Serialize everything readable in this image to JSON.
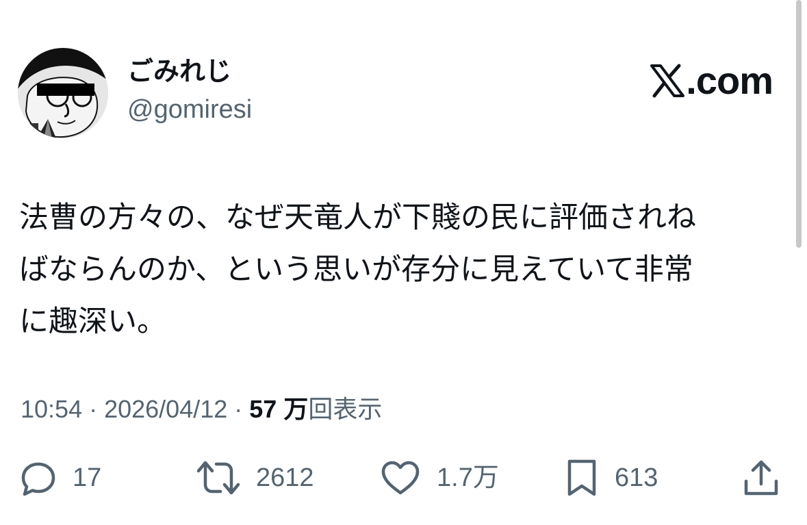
{
  "user": {
    "display_name": "ごみれじ",
    "handle": "@gomiresi",
    "avatar_icon": "manga-character-avatar-icon"
  },
  "brand": {
    "text": ".com",
    "icon": "x-logo-icon"
  },
  "tweet": {
    "text": "法曹の方々の、なぜ天竜人が下賤の民に評価されね\nばならんのか、という思いが存分に見えていて非常\nに趣深い。"
  },
  "meta": {
    "time": "10:54",
    "separator": " · ",
    "date": "2026/04/12",
    "views_count": "57 万",
    "views_label": "回表示"
  },
  "actions": {
    "reply": {
      "icon": "reply-icon",
      "count": "17"
    },
    "retweet": {
      "icon": "retweet-icon",
      "count": "2612"
    },
    "like": {
      "icon": "heart-icon",
      "count": "1.7万"
    },
    "bookmark": {
      "icon": "bookmark-icon",
      "count": "613"
    },
    "share": {
      "icon": "share-icon"
    }
  },
  "colors": {
    "text_primary": "#0f1419",
    "text_secondary": "#536471",
    "background": "#ffffff"
  }
}
